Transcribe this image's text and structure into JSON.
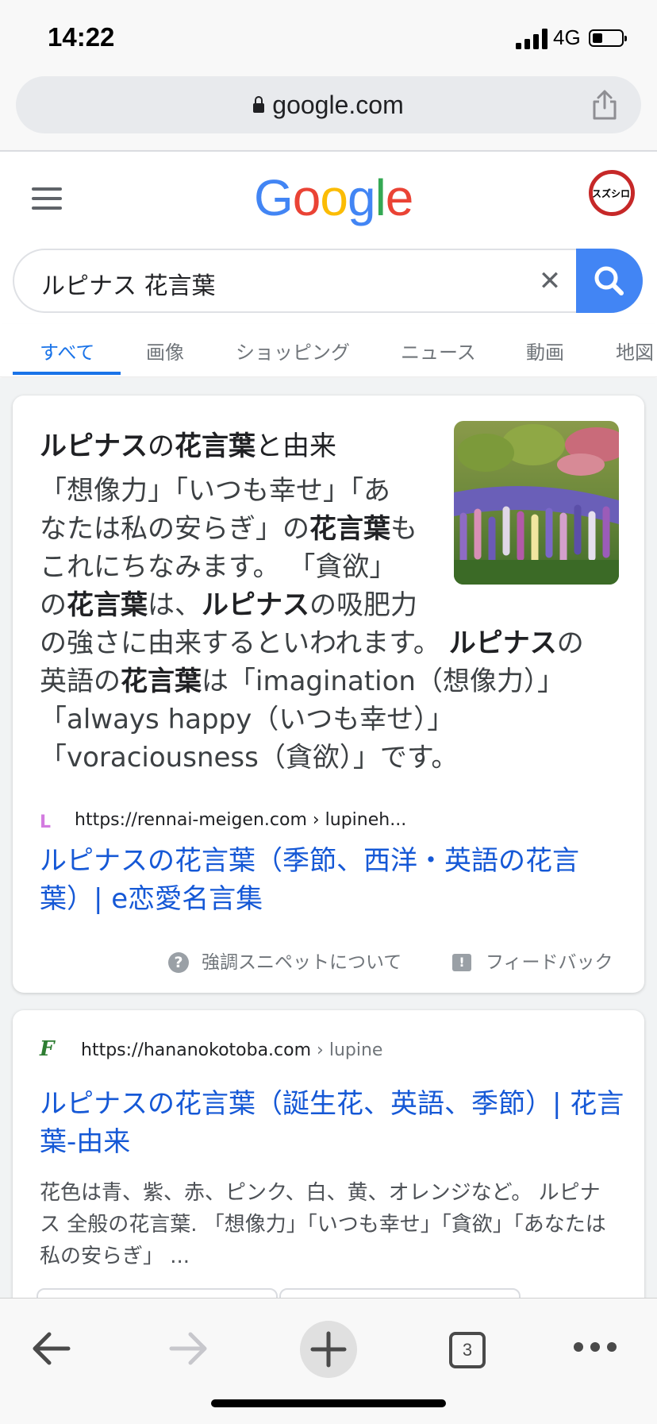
{
  "status_bar": {
    "time": "14:22",
    "network": "4G"
  },
  "browser": {
    "url": "google.com"
  },
  "google": {
    "logo": [
      "G",
      "o",
      "o",
      "g",
      "l",
      "e"
    ],
    "logo_colors": [
      "#4285f4",
      "#ea4335",
      "#fbbc05",
      "#4285f4",
      "#34a853",
      "#ea4335"
    ],
    "avatar_text": "スズシロー"
  },
  "search": {
    "query": "ルピナス 花言葉",
    "clear": "✕"
  },
  "tabs": [
    {
      "label": "すべて"
    },
    {
      "label": "画像"
    },
    {
      "label": "ショッピング"
    },
    {
      "label": "ニュース"
    },
    {
      "label": "動画"
    },
    {
      "label": "地図"
    }
  ],
  "snippet": {
    "title_b1": "ルピナス",
    "title_t1": "の",
    "title_b2": "花言葉",
    "title_t2": "と由来",
    "body": {
      "l1": "「想像力」「いつも幸せ」「あ",
      "l2a": "なたは私の安らぎ」の",
      "l2b": "花言葉",
      "l2c": "も",
      "l3": "これにちなみます。 「貪欲」",
      "l4a": "の",
      "l4b": "花言葉",
      "l4c": "は、",
      "l4d": "ルピナス",
      "l4e": "の吸肥力",
      "l5a": "の強さに由来するといわれます。 ",
      "l5b": "ルピナス",
      "l5c": "の",
      "l6a": "英語の",
      "l6b": "花言葉",
      "l6c": "は「imagination（想像力）」",
      "l7": "「always happy（いつも幸せ）」",
      "l8": "「voraciousness（貪欲）」です。"
    },
    "source_favicon": "L",
    "source": "https://rennai-meigen.com › lupineh...",
    "link_title": "ルピナスの花言葉（季節、西洋・英語の花言葉）| e恋愛名言集",
    "about_label": "強調スニペットについて",
    "feedback_label": "フィードバック"
  },
  "result2": {
    "favicon": "F",
    "domain": "https://hananokotoba.com",
    "path": " › lupine",
    "title": "ルピナスの花言葉（誕生花、英語、季節）| 花言葉-由来",
    "snippet": "花色は青、紫、赤、ピンク、白、黄、オレンジなど。 ルピナス 全般の花言葉. 「想像力」「いつも幸せ」「貪欲」「あなたは私の安らぎ」 ..."
  },
  "toolbar": {
    "tab_count": "3"
  }
}
